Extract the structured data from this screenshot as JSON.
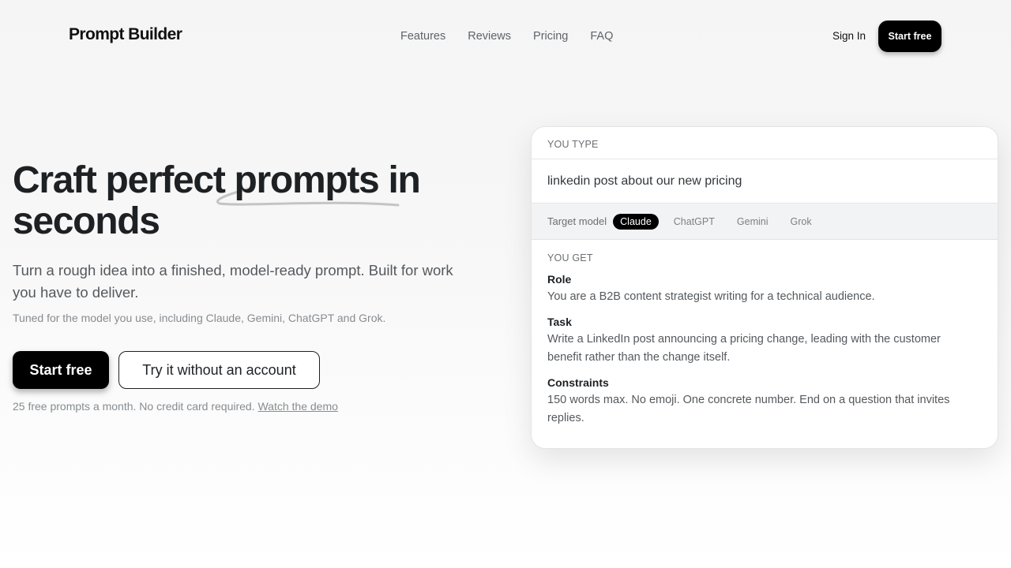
{
  "header": {
    "logo": "Prompt Builder",
    "nav": [
      "Features",
      "Reviews",
      "Pricing",
      "FAQ"
    ],
    "sign_in": "Sign In",
    "cta": "Start free"
  },
  "hero": {
    "title": "Craft perfect prompts in seconds",
    "subtitle": "Turn a rough idea into a finished, model-ready prompt. Built for work you have to deliver.",
    "note": "Tuned for the model you use, including Claude, Gemini, ChatGPT and Grok.",
    "primary_cta": "Start free",
    "secondary_cta": "Try it without an account",
    "fine_print": "25 free prompts a month. No credit card required.",
    "demo_link": "Watch the demo"
  },
  "card": {
    "you_type_label": "YOU TYPE",
    "input_value": "linkedin post about our new pricing",
    "target_model_label": "Target model",
    "models": [
      "Claude",
      "ChatGPT",
      "Gemini",
      "Grok"
    ],
    "selected_model": "Claude",
    "you_get_label": "YOU GET",
    "sections": [
      {
        "title": "Role",
        "text": "You are a B2B content strategist writing for a technical audience."
      },
      {
        "title": "Task",
        "text": "Write a LinkedIn post announcing a pricing change, leading with the customer benefit rather than the change itself."
      },
      {
        "title": "Constraints",
        "text": "150 words max. No emoji. One concrete number. End on a question that invites replies."
      }
    ]
  },
  "colors": {
    "primary": "#000000",
    "text": "#1d2124",
    "muted": "#55595d",
    "swoosh": "#c4c4c4"
  }
}
